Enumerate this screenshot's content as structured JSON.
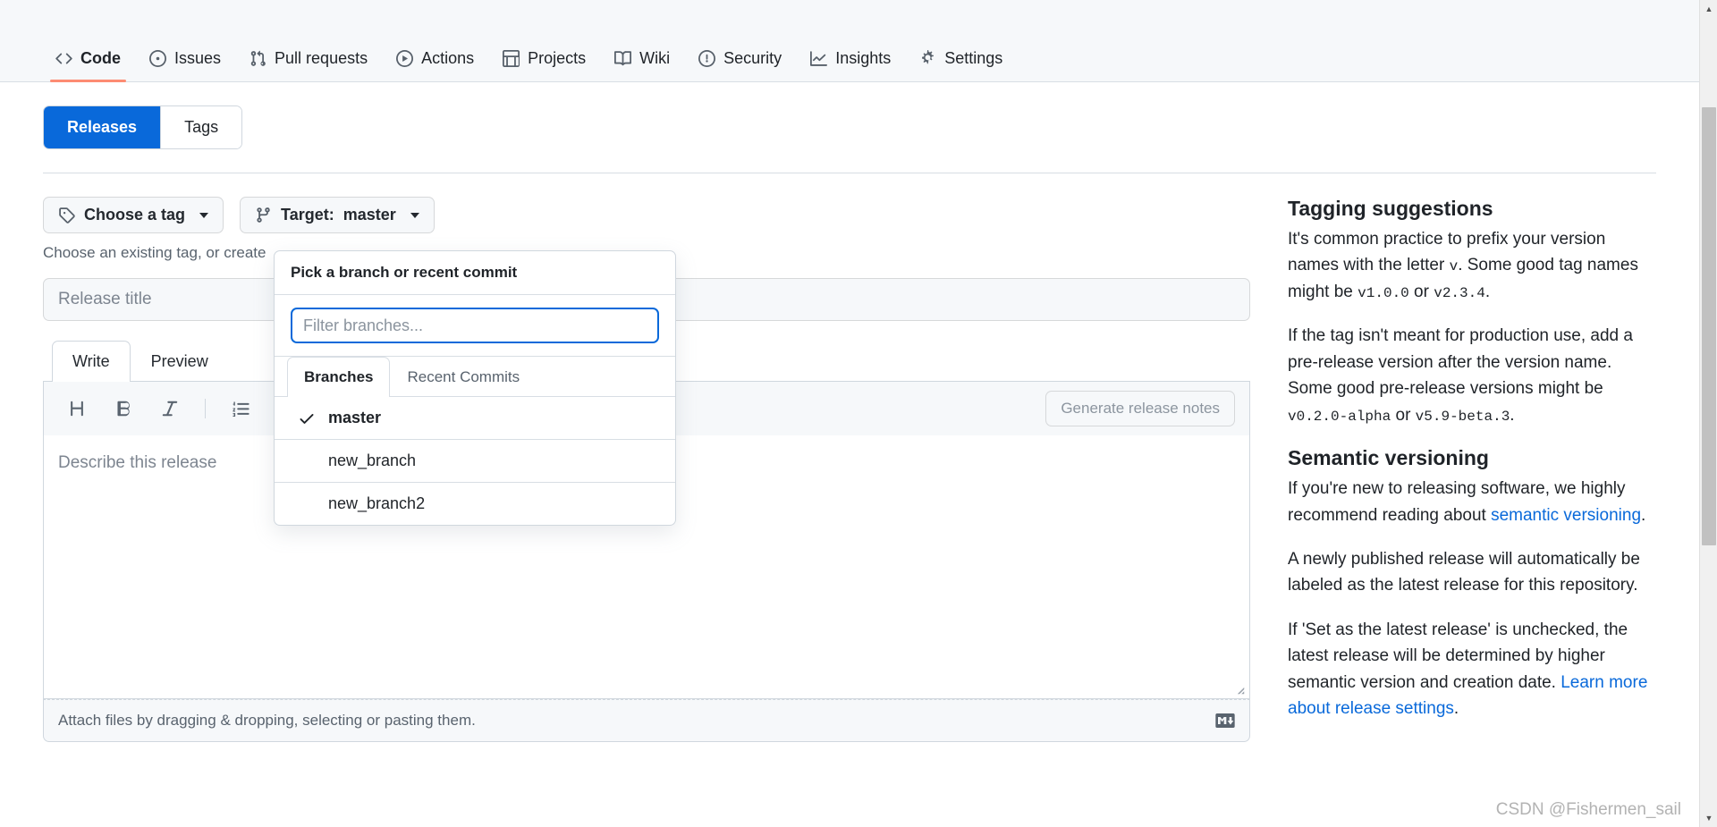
{
  "repo_nav": {
    "items": [
      {
        "label": "Code",
        "icon": "code-icon",
        "active": true
      },
      {
        "label": "Issues",
        "icon": "issue-icon",
        "active": false
      },
      {
        "label": "Pull requests",
        "icon": "git-pull-request-icon",
        "active": false
      },
      {
        "label": "Actions",
        "icon": "play-icon",
        "active": false
      },
      {
        "label": "Projects",
        "icon": "table-icon",
        "active": false
      },
      {
        "label": "Wiki",
        "icon": "book-icon",
        "active": false
      },
      {
        "label": "Security",
        "icon": "shield-icon",
        "active": false
      },
      {
        "label": "Insights",
        "icon": "graph-icon",
        "active": false
      },
      {
        "label": "Settings",
        "icon": "gear-icon",
        "active": false
      }
    ]
  },
  "segmented": {
    "releases_label": "Releases",
    "tags_label": "Tags",
    "selected": "Releases",
    "selected_bg": "#0969da"
  },
  "form": {
    "choose_tag_label": "Choose a tag",
    "target_label": "Target:",
    "target_value": "master",
    "helper_text": "Choose an existing tag, or create",
    "title_placeholder": "Release title"
  },
  "editor": {
    "tabs": [
      {
        "label": "Write",
        "active": true
      },
      {
        "label": "Preview",
        "active": false
      }
    ],
    "toolbar_icons": [
      "heading-icon",
      "bold-icon",
      "italic-icon",
      "ordered-list-icon",
      "code-icon"
    ],
    "generate_button_label": "Generate release notes",
    "generate_button_disabled": true,
    "body_placeholder": "Describe this release",
    "footer_text": "Attach files by dragging & dropping, selecting or pasting them.",
    "footer_badge": "markdown-icon"
  },
  "branch_dropdown": {
    "header": "Pick a branch or recent commit",
    "filter_placeholder": "Filter branches...",
    "filter_value": "",
    "focus_color": "#0969da",
    "tabs": [
      {
        "label": "Branches",
        "active": true
      },
      {
        "label": "Recent Commits",
        "active": false
      }
    ],
    "branches": [
      {
        "name": "master",
        "selected": true
      },
      {
        "name": "new_branch",
        "selected": false
      },
      {
        "name": "new_branch2",
        "selected": false
      }
    ]
  },
  "sidebar": {
    "sections": [
      {
        "heading": "Tagging suggestions",
        "paragraphs": [
          {
            "parts": [
              {
                "t": "It's common practice to prefix your version names with the letter ",
                "k": "text"
              },
              {
                "t": "v",
                "k": "code"
              },
              {
                "t": ". Some good tag names might be ",
                "k": "text"
              },
              {
                "t": "v1.0.0",
                "k": "code"
              },
              {
                "t": " or ",
                "k": "text"
              },
              {
                "t": "v2.3.4",
                "k": "code"
              },
              {
                "t": ".",
                "k": "text"
              }
            ]
          },
          {
            "parts": [
              {
                "t": "If the tag isn't meant for production use, add a pre-release version after the version name. Some good pre-release versions might be ",
                "k": "text"
              },
              {
                "t": "v0.2.0-alpha",
                "k": "code"
              },
              {
                "t": " or ",
                "k": "text"
              },
              {
                "t": "v5.9-beta.3",
                "k": "code"
              },
              {
                "t": ".",
                "k": "text"
              }
            ]
          }
        ]
      },
      {
        "heading": "Semantic versioning",
        "paragraphs": [
          {
            "parts": [
              {
                "t": "If you're new to releasing software, we highly recommend reading about ",
                "k": "text"
              },
              {
                "t": "semantic versioning",
                "k": "link"
              },
              {
                "t": ".",
                "k": "text"
              }
            ]
          },
          {
            "parts": [
              {
                "t": "A newly published release will automatically be labeled as the latest release for this repository.",
                "k": "text"
              }
            ]
          },
          {
            "parts": [
              {
                "t": "If 'Set as the latest release' is unchecked, the latest release will be determined by higher semantic version and creation date. ",
                "k": "text"
              },
              {
                "t": "Learn more about release settings",
                "k": "link"
              },
              {
                "t": ".",
                "k": "text"
              }
            ]
          }
        ]
      }
    ]
  },
  "watermark": {
    "text": "CSDN @Fishermen_sail"
  }
}
